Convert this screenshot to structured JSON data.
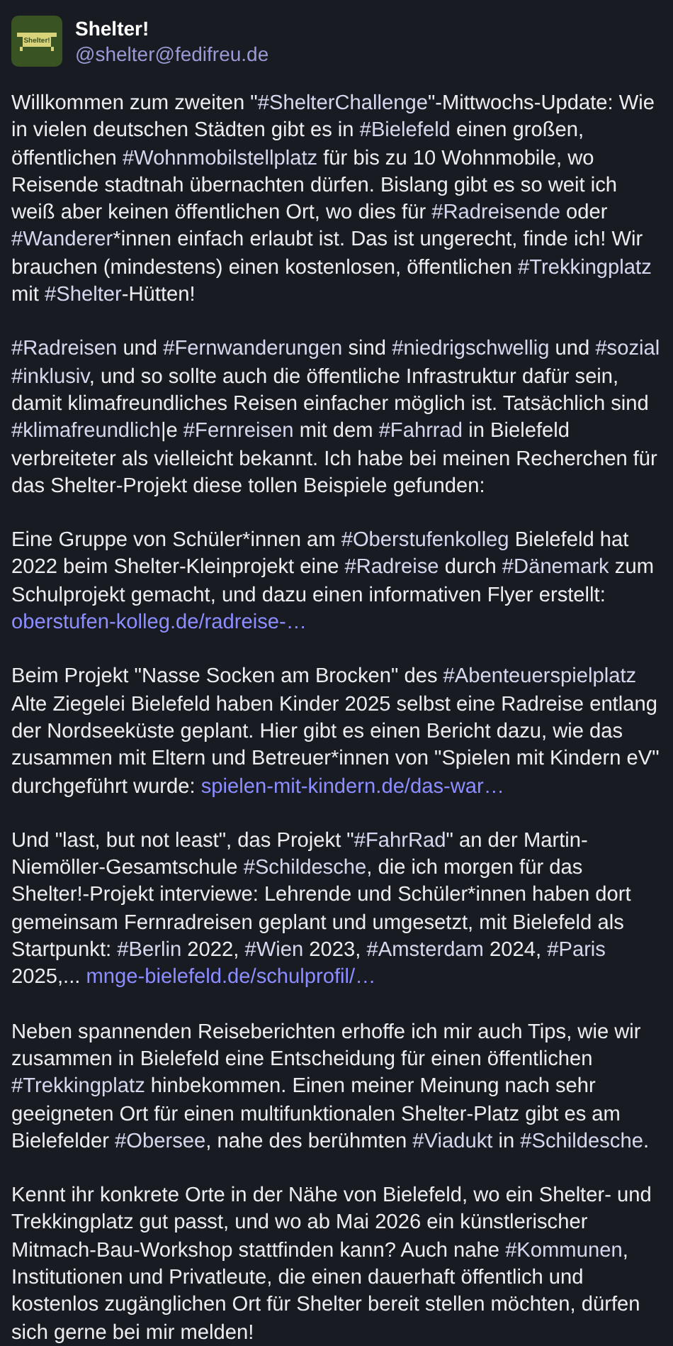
{
  "author": {
    "avatar_text": "Shelter!",
    "name": "Shelter!",
    "handle": "@shelter@fedifreu.de"
  },
  "paragraphs": [
    [
      {
        "kind": "text",
        "text": "Willkommen zum zweiten \""
      },
      {
        "kind": "hashtag",
        "text": "#ShelterChallenge"
      },
      {
        "kind": "text",
        "text": "\"-Mittwochs-Update: Wie in vielen deutschen Städten gibt es in "
      },
      {
        "kind": "hashtag",
        "text": "#Bielefeld"
      },
      {
        "kind": "text",
        "text": " einen großen, öffentlichen "
      },
      {
        "kind": "hashtag",
        "text": "#Wohnmobilstellplatz"
      },
      {
        "kind": "text",
        "text": " für bis zu 10 Wohnmobile, wo Reisende stadtnah übernachten dürfen. Bislang gibt es so weit ich weiß aber keinen öffentlichen Ort, wo dies für "
      },
      {
        "kind": "hashtag",
        "text": "#Radreisende"
      },
      {
        "kind": "text",
        "text": " oder "
      },
      {
        "kind": "hashtag",
        "text": "#Wanderer"
      },
      {
        "kind": "text",
        "text": "*innen einfach erlaubt ist. Das ist ungerecht, finde ich! Wir brauchen (mindestens) einen kostenlosen, öffentlichen "
      },
      {
        "kind": "hashtag",
        "text": "#Trekkingplatz"
      },
      {
        "kind": "text",
        "text": " mit "
      },
      {
        "kind": "hashtag",
        "text": "#Shelter"
      },
      {
        "kind": "text",
        "text": "-Hütten!"
      }
    ],
    [
      {
        "kind": "hashtag",
        "text": "#Radreisen"
      },
      {
        "kind": "text",
        "text": " und "
      },
      {
        "kind": "hashtag",
        "text": "#Fernwanderungen"
      },
      {
        "kind": "text",
        "text": " sind "
      },
      {
        "kind": "hashtag",
        "text": "#niedrigschwellig"
      },
      {
        "kind": "text",
        "text": " und "
      },
      {
        "kind": "hashtag",
        "text": "#sozial"
      },
      {
        "kind": "hashtag",
        "text": "#inklusiv"
      },
      {
        "kind": "text",
        "text": ", und so sollte auch die öffentliche Infrastruktur dafür sein, damit klimafreundliches Reisen einfacher möglich ist. Tatsächlich sind "
      },
      {
        "kind": "hashtag",
        "text": "#klimafreundlich"
      },
      {
        "kind": "text",
        "text": "|e "
      },
      {
        "kind": "hashtag",
        "text": "#Fernreisen"
      },
      {
        "kind": "text",
        "text": " mit dem "
      },
      {
        "kind": "hashtag",
        "text": "#Fahrrad"
      },
      {
        "kind": "text",
        "text": " in Bielefeld verbreiteter als vielleicht bekannt. Ich habe bei meinen Recherchen für das Shelter-Projekt diese tollen Beispiele gefunden:"
      }
    ],
    [
      {
        "kind": "text",
        "text": "Eine Gruppe von Schüler*innen am "
      },
      {
        "kind": "hashtag",
        "text": "#Oberstufenkolleg"
      },
      {
        "kind": "text",
        "text": " Bielefeld hat 2022 beim Shelter-Kleinprojekt eine "
      },
      {
        "kind": "hashtag",
        "text": "#Radreise"
      },
      {
        "kind": "text",
        "text": " durch "
      },
      {
        "kind": "hashtag",
        "text": "#Dänemark"
      },
      {
        "kind": "text",
        "text": " zum Schulprojekt gemacht, und dazu einen informativen Flyer erstellt: "
      },
      {
        "kind": "link",
        "text": "oberstufen-kolleg.de/radreise-…"
      }
    ],
    [
      {
        "kind": "text",
        "text": "Beim Projekt \"Nasse Socken am Brocken\" des "
      },
      {
        "kind": "hashtag",
        "text": "#Abenteuerspielplatz"
      },
      {
        "kind": "text",
        "text": " Alte Ziegelei Bielefeld haben Kinder 2025 selbst eine Radreise entlang der Nordseeküste geplant. Hier gibt es einen Bericht dazu, wie das zusammen mit Eltern und Betreuer*innen von \"Spielen mit Kindern eV\" durchgeführt wurde: "
      },
      {
        "kind": "link",
        "text": "spielen-mit-kindern.de/das-war…"
      }
    ],
    [
      {
        "kind": "text",
        "text": "Und \"last, but not least\", das Projekt \""
      },
      {
        "kind": "hashtag",
        "text": "#FahrRad"
      },
      {
        "kind": "text",
        "text": "\" an der Martin-Niemöller-Gesamtschule "
      },
      {
        "kind": "hashtag",
        "text": "#Schildesche"
      },
      {
        "kind": "text",
        "text": ", die ich morgen für das Shelter!-Projekt interviewe: Lehrende und Schüler*innen haben dort gemeinsam Fernradreisen geplant und umgesetzt, mit Bielefeld als Startpunkt: "
      },
      {
        "kind": "hashtag",
        "text": "#Berlin"
      },
      {
        "kind": "text",
        "text": " 2022, "
      },
      {
        "kind": "hashtag",
        "text": "#Wien"
      },
      {
        "kind": "text",
        "text": " 2023, "
      },
      {
        "kind": "hashtag",
        "text": "#Amsterdam"
      },
      {
        "kind": "text",
        "text": " 2024, "
      },
      {
        "kind": "hashtag",
        "text": "#Paris"
      },
      {
        "kind": "text",
        "text": " 2025,... "
      },
      {
        "kind": "link",
        "text": "mnge-bielefeld.de/schulprofil/…"
      }
    ],
    [
      {
        "kind": "text",
        "text": "Neben spannenden Reiseberichten erhoffe ich mir auch Tips, wie wir zusammen in Bielefeld eine Entscheidung für einen öffentlichen "
      },
      {
        "kind": "hashtag",
        "text": "#Trekkingplatz"
      },
      {
        "kind": "text",
        "text": " hinbekommen. Einen meiner Meinung nach sehr geeigneten Ort für einen multifunktionalen Shelter-Platz gibt es am Bielefelder "
      },
      {
        "kind": "hashtag",
        "text": "#Obersee"
      },
      {
        "kind": "text",
        "text": ", nahe des berühmten "
      },
      {
        "kind": "hashtag",
        "text": "#Viadukt"
      },
      {
        "kind": "text",
        "text": " in "
      },
      {
        "kind": "hashtag",
        "text": "#Schildesche"
      },
      {
        "kind": "text",
        "text": "."
      }
    ],
    [
      {
        "kind": "text",
        "text": "Kennt ihr konkrete Orte in der Nähe von Bielefeld, wo ein Shelter- und Trekkingplatz gut passt, und wo ab Mai 2026 ein künstlerischer Mitmach-Bau-Workshop stattfinden kann? Auch nahe "
      },
      {
        "kind": "hashtag",
        "text": "#Kommunen"
      },
      {
        "kind": "text",
        "text": ", Institutionen und Privatleute, die einen dauerhaft öffentlich und kostenlos zugänglichen Ort für Shelter bereit stellen möchten, dürfen sich gerne bei mir melden!"
      }
    ]
  ]
}
